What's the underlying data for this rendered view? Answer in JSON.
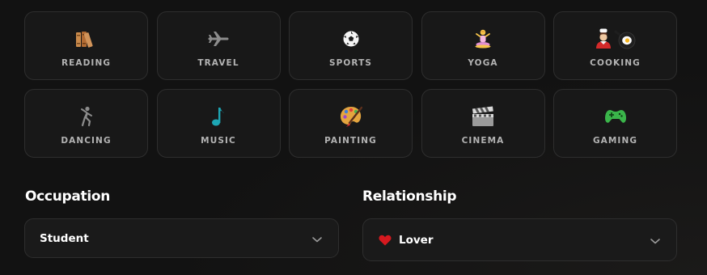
{
  "interests": [
    {
      "id": "reading",
      "label": "READING",
      "icon": "books-icon"
    },
    {
      "id": "travel",
      "label": "TRAVEL",
      "icon": "airplane-icon"
    },
    {
      "id": "sports",
      "label": "SPORTS",
      "icon": "soccer-ball-icon"
    },
    {
      "id": "yoga",
      "label": "YOGA",
      "icon": "yoga-icon"
    },
    {
      "id": "cooking",
      "label": "COOKING",
      "icon": "cook-icon"
    },
    {
      "id": "dancing",
      "label": "DANCING",
      "icon": "dancer-icon"
    },
    {
      "id": "music",
      "label": "MUSIC",
      "icon": "music-note-icon"
    },
    {
      "id": "painting",
      "label": "PAINTING",
      "icon": "palette-icon"
    },
    {
      "id": "cinema",
      "label": "CINEMA",
      "icon": "clapperboard-icon"
    },
    {
      "id": "gaming",
      "label": "GAMING",
      "icon": "gamepad-icon"
    }
  ],
  "occupation": {
    "title": "Occupation",
    "value": "Student"
  },
  "relationship": {
    "title": "Relationship",
    "value": "Lover",
    "icon": "heart-icon"
  },
  "colors": {
    "background": "#121212",
    "tile": "#181818",
    "border": "#2e2e2e",
    "label": "#b3b3b3",
    "heart": "#d6191f",
    "music": "#1da6b4",
    "gaming": "#3ab54a"
  }
}
